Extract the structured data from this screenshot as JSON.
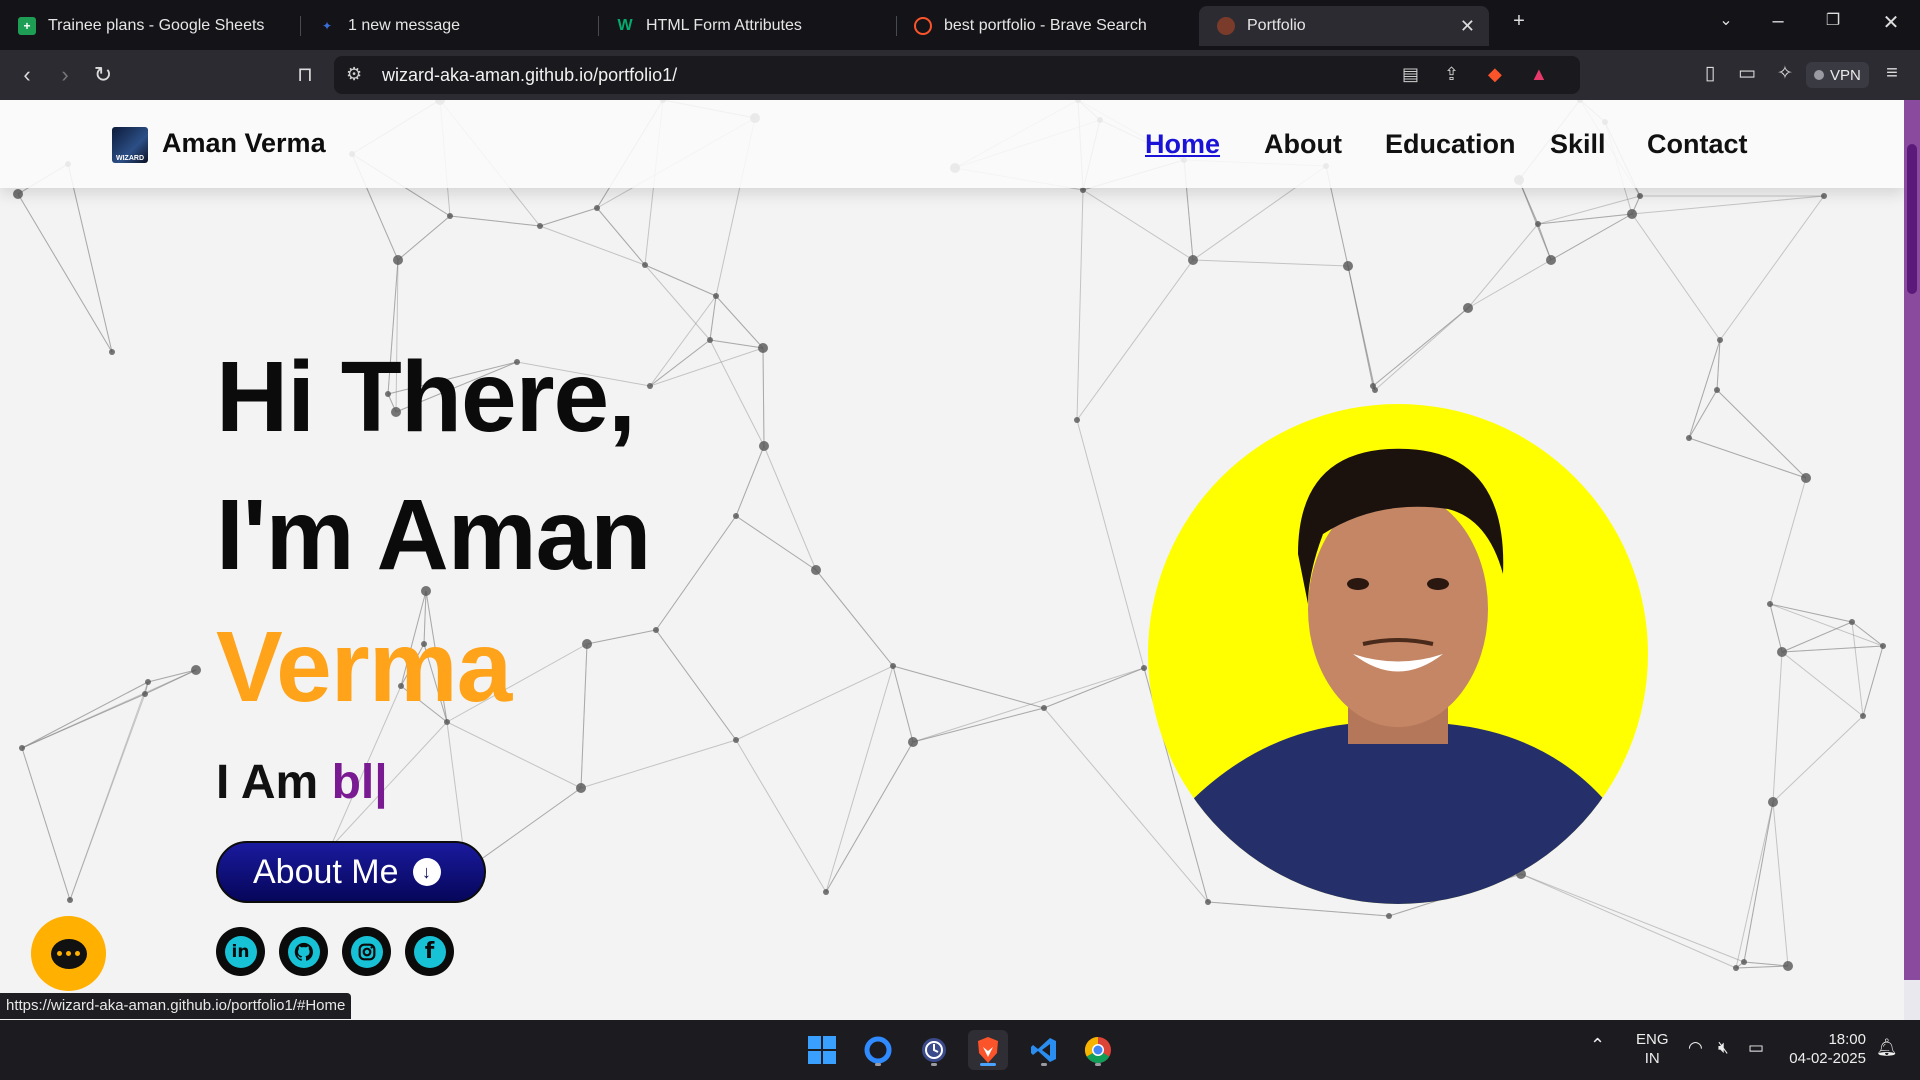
{
  "browser": {
    "tabs": [
      {
        "title": "Trainee plans - Google Sheets",
        "icon": "google-sheets-icon",
        "color": "#1e9e55"
      },
      {
        "title": "1 new message",
        "icon": "message-icon",
        "color": "#3a6fd8"
      },
      {
        "title": "HTML Form Attributes",
        "icon": "w3schools-icon",
        "color": "#04aa6d"
      },
      {
        "title": "best portfolio - Brave Search",
        "icon": "brave-search-icon",
        "color": "#fb542b"
      },
      {
        "title": "Portfolio",
        "icon": "portfolio-icon",
        "color": "#7a3b2a",
        "active": true
      }
    ],
    "url": "wizard-aka-aman.github.io/portfolio1/",
    "vpn_label": "VPN",
    "status_url": "https://wizard-aka-aman.github.io/portfolio1/#Home"
  },
  "page": {
    "brand": "Aman Verma",
    "logo_text": "WIZARD",
    "nav": [
      {
        "label": "Home",
        "active": true
      },
      {
        "label": "About"
      },
      {
        "label": "Education"
      },
      {
        "label": "Skill"
      },
      {
        "label": "Contact"
      }
    ],
    "hero": {
      "line1": "Hi There,",
      "line2": "I'm Aman",
      "line3": "Verma",
      "iam_prefix": "I Am ",
      "iam_typed": "bl|",
      "about_button": "About Me"
    },
    "social": [
      "linkedin-icon",
      "github-icon",
      "instagram-icon",
      "facebook-icon"
    ],
    "colors": {
      "accent": "#ffa31a",
      "typed": "#7a1a92",
      "button": "#06065a",
      "photo_bg": "#ffff00"
    }
  },
  "taskbar": {
    "apps": [
      "windows-start-icon",
      "copilot-icon",
      "clock-app-icon",
      "brave-browser-icon",
      "vscode-icon",
      "chrome-icon"
    ],
    "language": "ENG",
    "region": "IN",
    "time": "18:00",
    "date": "04-02-2025"
  }
}
